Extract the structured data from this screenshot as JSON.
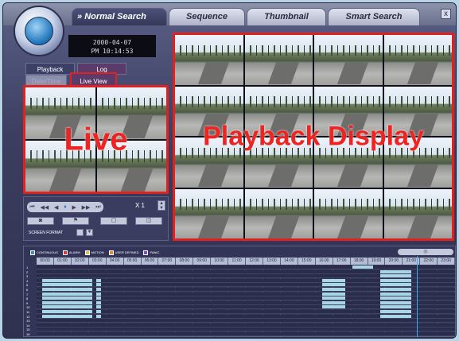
{
  "window": {
    "tabs": [
      {
        "label": "Normal Search",
        "prefix": "»"
      },
      {
        "label": "Sequence"
      },
      {
        "label": "Thumbnail"
      },
      {
        "label": "Smart Search"
      }
    ],
    "close_label": "x"
  },
  "time_display": {
    "date": "2000-04-07",
    "time": "PM 10:14:53"
  },
  "left_tabs": {
    "playback": "Playback",
    "log": "Log",
    "datetime": "Date/Time",
    "live_view": "Live View"
  },
  "live": {
    "overlay": "Live",
    "tiles": 4
  },
  "playback": {
    "overlay": "Playback Display",
    "tiles": 16
  },
  "controls": {
    "transport": [
      "⏮",
      "◀◀",
      "◀",
      "⏸",
      "▶",
      "▶▶",
      "⏭"
    ],
    "speed": "X 1",
    "buttons": [
      "◙",
      "⚑",
      "▢",
      "◫"
    ],
    "screen_format_label": "SCREEN FORMAT"
  },
  "timeline": {
    "legend": [
      {
        "label": "CONTINUOUS",
        "color": "#4a86d6"
      },
      {
        "label": "ALARM",
        "color": "#c83b3b"
      },
      {
        "label": "MOTION",
        "color": "#e0c54a"
      },
      {
        "label": "USER DEFINED",
        "color": "#e08d3a"
      },
      {
        "label": "PANIC",
        "color": "#7b4fb3"
      }
    ],
    "zoom_label": "◎",
    "hours": [
      "00:00",
      "01:00",
      "02:00",
      "03:00",
      "04:00",
      "05:00",
      "06:00",
      "07:00",
      "08:00",
      "09:00",
      "10:00",
      "11:00",
      "12:00",
      "13:00",
      "14:00",
      "15:00",
      "16:00",
      "17:00",
      "18:00",
      "19:00",
      "20:00",
      "21:00",
      "22:00",
      "23:00"
    ],
    "end_hour": "23:00",
    "cursor_hour": 21.8,
    "channels": [
      "1",
      "2",
      "3",
      "4",
      "5",
      "6",
      "7",
      "8",
      "9",
      "10",
      "11",
      "12",
      "13",
      "14",
      "15",
      "16"
    ],
    "segments": [
      {
        "row": 0,
        "start": 18.1,
        "end": 19.3
      },
      {
        "row": 1,
        "start": 19.7,
        "end": 21.5
      },
      {
        "row": 2,
        "start": 19.7,
        "end": 21.5
      },
      {
        "row": 3,
        "start": 0.3,
        "end": 3.2
      },
      {
        "row": 3,
        "start": 3.4,
        "end": 3.7
      },
      {
        "row": 3,
        "start": 16.4,
        "end": 17.7
      },
      {
        "row": 3,
        "start": 19.7,
        "end": 21.5
      },
      {
        "row": 4,
        "start": 0.3,
        "end": 3.2
      },
      {
        "row": 4,
        "start": 3.4,
        "end": 3.7
      },
      {
        "row": 4,
        "start": 16.4,
        "end": 17.7
      },
      {
        "row": 4,
        "start": 19.7,
        "end": 21.5
      },
      {
        "row": 5,
        "start": 0.3,
        "end": 3.2
      },
      {
        "row": 5,
        "start": 3.4,
        "end": 3.7
      },
      {
        "row": 5,
        "start": 16.4,
        "end": 17.7
      },
      {
        "row": 5,
        "start": 19.7,
        "end": 21.5
      },
      {
        "row": 6,
        "start": 0.3,
        "end": 3.2
      },
      {
        "row": 6,
        "start": 3.4,
        "end": 3.7
      },
      {
        "row": 6,
        "start": 16.4,
        "end": 17.7
      },
      {
        "row": 6,
        "start": 19.7,
        "end": 21.5
      },
      {
        "row": 7,
        "start": 0.3,
        "end": 3.2
      },
      {
        "row": 7,
        "start": 3.4,
        "end": 3.7
      },
      {
        "row": 7,
        "start": 16.4,
        "end": 17.7
      },
      {
        "row": 7,
        "start": 19.7,
        "end": 21.5
      },
      {
        "row": 8,
        "start": 0.3,
        "end": 3.2
      },
      {
        "row": 8,
        "start": 3.4,
        "end": 3.7
      },
      {
        "row": 8,
        "start": 16.4,
        "end": 17.7
      },
      {
        "row": 8,
        "start": 19.7,
        "end": 21.5
      },
      {
        "row": 9,
        "start": 0.3,
        "end": 3.2
      },
      {
        "row": 9,
        "start": 3.4,
        "end": 3.7
      },
      {
        "row": 9,
        "start": 16.4,
        "end": 17.7
      },
      {
        "row": 9,
        "start": 19.7,
        "end": 21.5
      },
      {
        "row": 10,
        "start": 0.3,
        "end": 3.2
      },
      {
        "row": 10,
        "start": 3.4,
        "end": 3.7
      },
      {
        "row": 10,
        "start": 19.7,
        "end": 21.5
      },
      {
        "row": 11,
        "start": 0.3,
        "end": 3.2
      },
      {
        "row": 11,
        "start": 3.4,
        "end": 3.7
      },
      {
        "row": 11,
        "start": 19.7,
        "end": 21.5
      }
    ]
  }
}
